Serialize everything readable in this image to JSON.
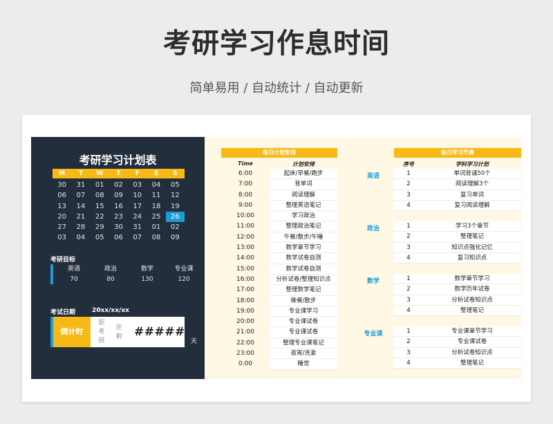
{
  "header": {
    "title": "考研学习作息时间",
    "subtitle": "简单易用 / 自动统计 / 自动更新"
  },
  "planner": {
    "title": "考研学习计划表",
    "weekdays": [
      "M",
      "T",
      "W",
      "T",
      "F",
      "S",
      "S"
    ],
    "calendar": [
      [
        "30",
        "31",
        "01",
        "02",
        "03",
        "04",
        "05"
      ],
      [
        "06",
        "07",
        "08",
        "09",
        "10",
        "11",
        "12"
      ],
      [
        "13",
        "14",
        "15",
        "16",
        "17",
        "18",
        "19"
      ],
      [
        "20",
        "21",
        "22",
        "23",
        "24",
        "25",
        "26"
      ],
      [
        "27",
        "28",
        "29",
        "30",
        "31",
        "01",
        "02"
      ],
      [
        "03",
        "04",
        "05",
        "06",
        "07",
        "08",
        "09"
      ]
    ],
    "today": "26",
    "goals_label": "考研目标",
    "goals": [
      {
        "subject": "英语",
        "score": "70"
      },
      {
        "subject": "政治",
        "score": "80"
      },
      {
        "subject": "数学",
        "score": "130"
      },
      {
        "subject": "专业课",
        "score": "120"
      }
    ],
    "exam_date_label": "考试日期",
    "exam_date_value": "20xx/xx/xx",
    "countdown_label": "倒计时",
    "countdown_chars_1": [
      "距",
      "考",
      "研"
    ],
    "countdown_chars_2": [
      "还",
      "剩"
    ],
    "countdown_value": "#####",
    "days_unit": "天"
  },
  "daily": {
    "header": "每日计划安排",
    "col_time": "Time",
    "col_plan": "计划安排",
    "rows": [
      [
        "6:00",
        "起床/早餐/跑步"
      ],
      [
        "7:00",
        "背单词"
      ],
      [
        "8:00",
        "阅读理解"
      ],
      [
        "9:00",
        "整理英语笔记"
      ],
      [
        "10:00",
        "学习政治"
      ],
      [
        "11:00",
        "整理政治笔记"
      ],
      [
        "12:00",
        "午餐/散步/午睡"
      ],
      [
        "13:00",
        "数学章节学习"
      ],
      [
        "14:00",
        "数学试卷自测"
      ],
      [
        "15:00",
        "数学试卷自测"
      ],
      [
        "16:00",
        "分析试卷/整理知识点"
      ],
      [
        "17:00",
        "整理数学笔记"
      ],
      [
        "18:00",
        "晚餐/散步"
      ],
      [
        "19:00",
        "专业课学习"
      ],
      [
        "20:00",
        "专业课试卷"
      ],
      [
        "21:00",
        "专业课试卷"
      ],
      [
        "22:00",
        "整理专业课笔记"
      ],
      [
        "23:00",
        "夜宵/洗漱"
      ],
      [
        "0:00",
        "睡觉"
      ]
    ]
  },
  "subjects": {
    "header": "每日学习节奏",
    "col_no": "序号",
    "col_plan": "学科学习计划",
    "groups": [
      {
        "name": "英语",
        "items": [
          [
            "1",
            "单词背诵50个"
          ],
          [
            "2",
            "阅读理解3个"
          ],
          [
            "3",
            "复习单词"
          ],
          [
            "4",
            "复习阅读理解"
          ]
        ]
      },
      {
        "name": "政治",
        "items": [
          [
            "1",
            "学习3个章节"
          ],
          [
            "2",
            "整理笔记"
          ],
          [
            "3",
            "知识点强化记忆"
          ],
          [
            "4",
            "复习知识点"
          ]
        ]
      },
      {
        "name": "数学",
        "items": [
          [
            "1",
            "数学章节学习"
          ],
          [
            "2",
            "数学历年试卷"
          ],
          [
            "3",
            "分析试卷知识点"
          ],
          [
            "4",
            "整理笔记"
          ]
        ]
      },
      {
        "name": "专业课",
        "items": [
          [
            "1",
            "专业课章节学习"
          ],
          [
            "2",
            "专业课试卷"
          ],
          [
            "3",
            "分析试卷知识点"
          ],
          [
            "4",
            "整理笔记"
          ]
        ]
      }
    ]
  }
}
